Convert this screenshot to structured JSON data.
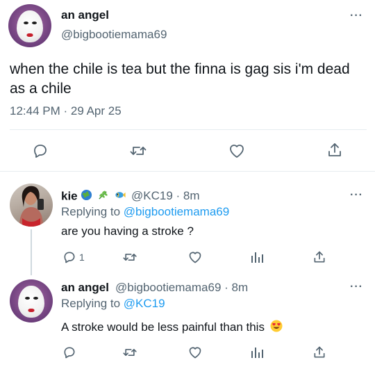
{
  "main_tweet": {
    "author_name": "an angel",
    "handle": "@bigbootiemama69",
    "text": "when the chile is tea but the finna is gag sis i'm dead as a chile",
    "timestamp": "12:44 PM · 29 Apr 25",
    "more_label": "···"
  },
  "replies": [
    {
      "author_name": "kie",
      "handle": "@KC19",
      "time": "· 8m",
      "replying_prefix": "Replying to",
      "replying_to": "@bigbootiemama69",
      "text": "are you having a stroke ?",
      "reply_count": "1",
      "more_label": "···"
    },
    {
      "author_name": "an angel",
      "handle": "@bigbootiemama69",
      "time": "· 8m",
      "replying_prefix": "Replying to",
      "replying_to": "@KC19",
      "text": "A stroke would be less painful than this",
      "more_label": "···"
    }
  ],
  "icons": {
    "reply": "reply-icon",
    "retweet": "retweet-icon",
    "like": "heart-icon",
    "share": "share-icon",
    "analytics": "analytics-icon",
    "more": "more-icon"
  },
  "colors": {
    "text_primary": "#0f1419",
    "text_secondary": "#536471",
    "link": "#1d9bf0",
    "divider": "#e6ecf0"
  }
}
